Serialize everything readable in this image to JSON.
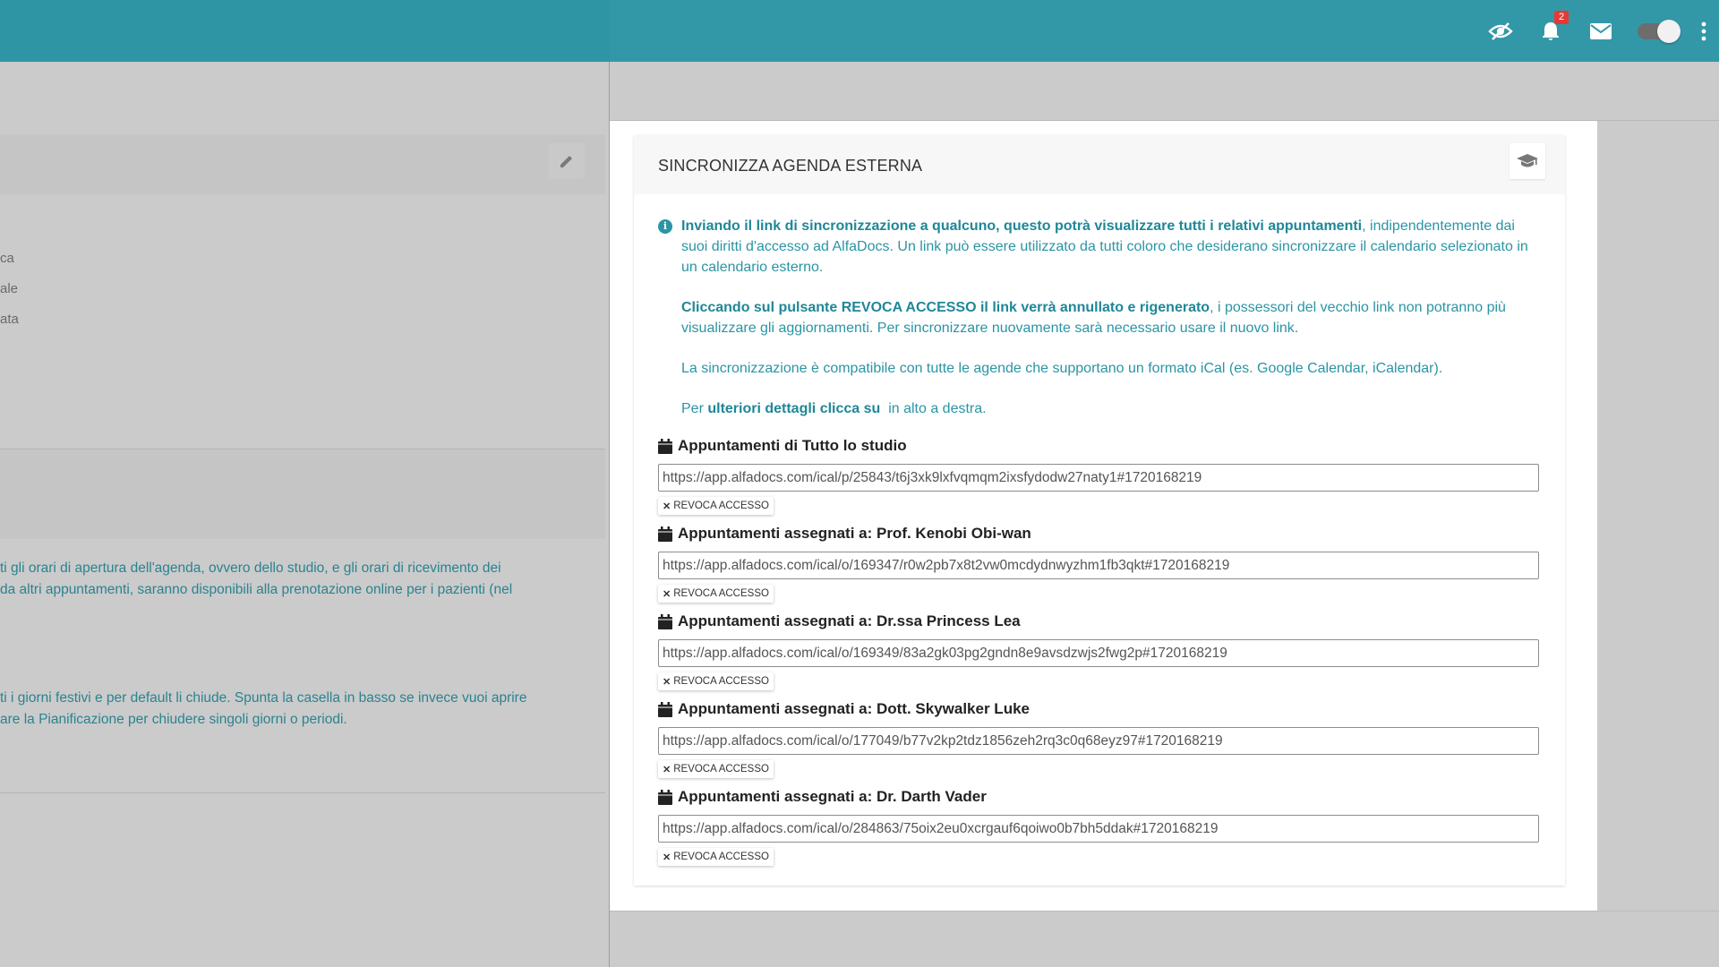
{
  "topbar": {
    "notifications_count": "2",
    "icons": [
      "eye-off-icon",
      "bell-icon",
      "mail-icon",
      "toggle-switch",
      "more-vert-icon"
    ]
  },
  "background_left": {
    "lines": [
      "ca",
      "ale",
      "ata"
    ],
    "para1": [
      "ti gli orari di apertura dell'agenda, ovvero dello studio, e gli orari di ricevimento dei",
      "da altri appuntamenti, saranno disponibili alla prenotazione online per i pazienti (nel"
    ],
    "para2": [
      "ti i giorni festivi e per default li chiude. Spunta la casella in basso se invece vuoi aprire",
      "are la Pianificazione per chiudere singoli giorni o periodi."
    ]
  },
  "modal": {
    "title": "SINCRONIZZA AGENDA ESTERNA",
    "info": {
      "p1_bold": "Inviando il link di sincronizzazione a qualcuno, questo potrà visualizzare tutti i relativi appuntamenti",
      "p1_rest": ", indipendentemente dai suoi diritti d'accesso ad AlfaDocs. Un link può essere utilizzato da tutti coloro che desiderano sincronizzare il calendario selezionato in un calendario esterno.",
      "p2_bold": "Cliccando sul pulsante REVOCA ACCESSO il link verrà annullato e rigenerato",
      "p2_rest": ", i possessori del vecchio link non potranno più visualizzare gli aggiornamenti. Per sincronizzare nuovamente sarà necessario usare il nuovo link.",
      "p3": "La sincronizzazione è compatibile con tutte le agende che supportano un formato iCal (es. Google Calendar, iCalendar).",
      "p4_pre": "Per ",
      "p4_bold": "ulteriori dettagli clicca su",
      "p4_post": "  in alto a destra."
    },
    "revoke_label": "REVOCA ACCESSO",
    "calendars": [
      {
        "title": "Appuntamenti di Tutto lo studio",
        "url": "https://app.alfadocs.com/ical/p/25843/t6j3xk9lxfvqmqm2ixsfydodw27naty1#1720168219"
      },
      {
        "title": "Appuntamenti assegnati a: Prof. Kenobi Obi-wan",
        "url": "https://app.alfadocs.com/ical/o/169347/r0w2pb7x8t2vw0mcdydnwyzhm1fb3qkt#1720168219"
      },
      {
        "title": "Appuntamenti assegnati a: Dr.ssa Princess Lea",
        "url": "https://app.alfadocs.com/ical/o/169349/83a2gk03pg2gndn8e9avsdzwjs2fwg2p#1720168219"
      },
      {
        "title": "Appuntamenti assegnati a: Dott. Skywalker Luke",
        "url": "https://app.alfadocs.com/ical/o/177049/b77v2kp2tdz1856zeh2rq3c0q68eyz97#1720168219"
      },
      {
        "title": "Appuntamenti assegnati a: Dr. Darth Vader",
        "url": "https://app.alfadocs.com/ical/o/284863/75oix2eu0xcrgauf6qoiwo0b7bh5ddak#1720168219"
      }
    ]
  }
}
